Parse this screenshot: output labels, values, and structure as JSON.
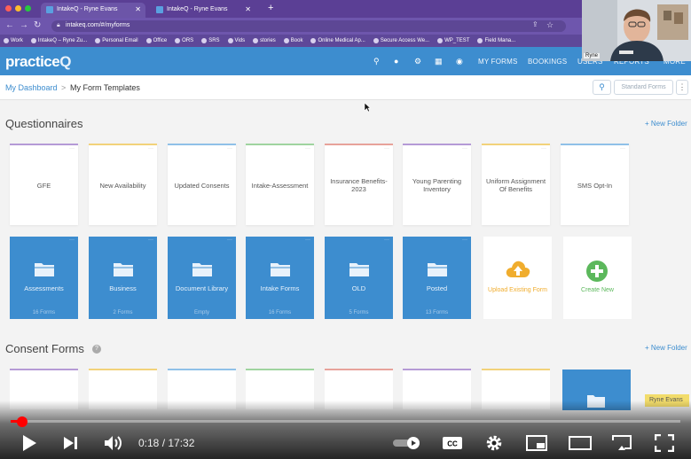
{
  "browser": {
    "tabs": [
      {
        "label": "IntakeQ - Ryne Evans",
        "active": true
      },
      {
        "label": "IntakeQ - Ryne Evans",
        "active": false
      }
    ],
    "url": "intakeq.com/#/myforms",
    "bookmarks": [
      "Work",
      "IntakeQ – Ryne Zu...",
      "Personal Email",
      "Office",
      "ORS",
      "SRS",
      "Vids",
      "stories",
      "Book",
      "Online Medical Ap...",
      "Secure Access We...",
      "WP_TEST",
      "Field Mana..."
    ]
  },
  "app": {
    "logo_main": "practice",
    "logo_q": "Q",
    "nav": {
      "my_forms": "MY FORMS",
      "bookings": "BOOKINGS",
      "users": "USERS",
      "reports": "REPORTS",
      "more": "MORE"
    }
  },
  "breadcrumb": {
    "home": "My Dashboard",
    "sep": ">",
    "current": "My Form Templates"
  },
  "toolbar": {
    "standard_forms": "Standard Forms",
    "more": "⋮"
  },
  "questionnaires": {
    "title": "Questionnaires",
    "new_folder": "+ New Folder",
    "cards": [
      {
        "label": "GFE",
        "color": "#b59ad6"
      },
      {
        "label": "New Availability",
        "color": "#f2d27a"
      },
      {
        "label": "Updated Consents",
        "color": "#8fc0e8"
      },
      {
        "label": "Intake-Assessment",
        "color": "#9fd49f"
      },
      {
        "label": "Insurance Benefits-2023",
        "color": "#e7a29a"
      },
      {
        "label": "Young Parenting Inventory",
        "color": "#b59ad6"
      },
      {
        "label": "Uniform Assignment Of Benefits",
        "color": "#f2d27a"
      },
      {
        "label": "SMS Opt-In",
        "color": "#8fc0e8"
      }
    ],
    "folders": [
      {
        "name": "Assessments",
        "count": "16 Forms"
      },
      {
        "name": "Business",
        "count": "2 Forms"
      },
      {
        "name": "Document Library",
        "count": "Empty"
      },
      {
        "name": "Intake Forms",
        "count": "16 Forms"
      },
      {
        "name": "OLD",
        "count": "5 Forms"
      },
      {
        "name": "Posted",
        "count": "13 Forms"
      }
    ],
    "upload_label": "Upload Existing Form",
    "create_label": "Create New",
    "upload_color": "#f0ad2e",
    "create_color": "#5cb85c"
  },
  "consent": {
    "title": "Consent Forms",
    "new_folder": "+ New Folder",
    "card_colors": [
      "#b59ad6",
      "#f2d27a",
      "#8fc0e8",
      "#9fd49f",
      "#e7a29a",
      "#b59ad6",
      "#f2d27a"
    ]
  },
  "overlay": {
    "presenter_name": "Ryne Evans",
    "webcam_name": "Ryne"
  },
  "player": {
    "current_time": "0:18",
    "duration": "17:32",
    "time_display": "0:18 / 17:32",
    "progress": 0.017,
    "progress_color": "#ff0000"
  }
}
